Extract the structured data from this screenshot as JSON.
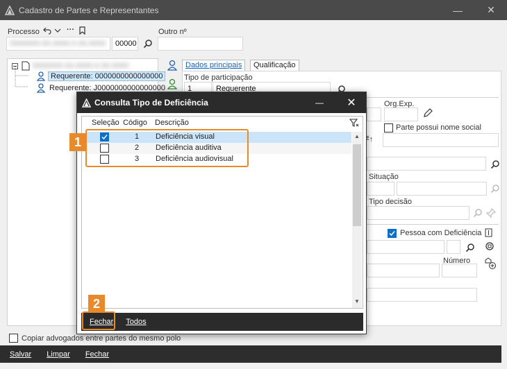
{
  "window": {
    "title": "Cadastro de Partes e Representantes",
    "minimize": "—",
    "close": "✕"
  },
  "form": {
    "processo_label": "Processo",
    "processo_number": "0000000-00.0000.0.00.0000",
    "processo_suffix": "00000",
    "outro_label": "Outro nº",
    "outro_value": ""
  },
  "tree": {
    "root": "0000000-00.0000.0.00.0000",
    "items": [
      {
        "label": "Requerente: 0000000000000000"
      },
      {
        "label": "Requerente: J0000000000000000"
      }
    ]
  },
  "tabs": [
    {
      "label": "Dados principais"
    },
    {
      "label": "Qualificação"
    }
  ],
  "main": {
    "tipo_label": "Tipo de participação",
    "tipo_code": "1",
    "tipo_value": "Requerente",
    "org_exp_label": "Org.Exp.",
    "nome_social_label": "Parte possui nome social",
    "situacao_label": "Situação",
    "tipo_decisao_label": "Tipo decisão",
    "pessoa_deficiencia_label": "Pessoa com Deficiência",
    "numero_label": "Número",
    "copiar_label": "Copiar advogados entre partes do mesmo polo"
  },
  "bottombar": {
    "salvar": "Salvar",
    "limpar": "Limpar",
    "fechar": "Fechar"
  },
  "modal": {
    "title": "Consulta Tipo de Deficiência",
    "minimize": "—",
    "close": "✕",
    "columns": [
      "Seleção",
      "Código",
      "Descrição"
    ],
    "rows": [
      {
        "selected": true,
        "code": "1",
        "desc": "Deficiência visual"
      },
      {
        "selected": false,
        "code": "2",
        "desc": "Deficiência auditiva"
      },
      {
        "selected": false,
        "code": "3",
        "desc": "Deficiência audiovisual"
      }
    ],
    "buttons": {
      "fechar": "Fechar",
      "todos": "Todos"
    }
  },
  "annotations": {
    "badge1": "1",
    "badge2": "2"
  },
  "colors": {
    "accent": "#0f6fc6",
    "highlight": "#e88a2c",
    "titlebar": "#4a4a4a"
  }
}
